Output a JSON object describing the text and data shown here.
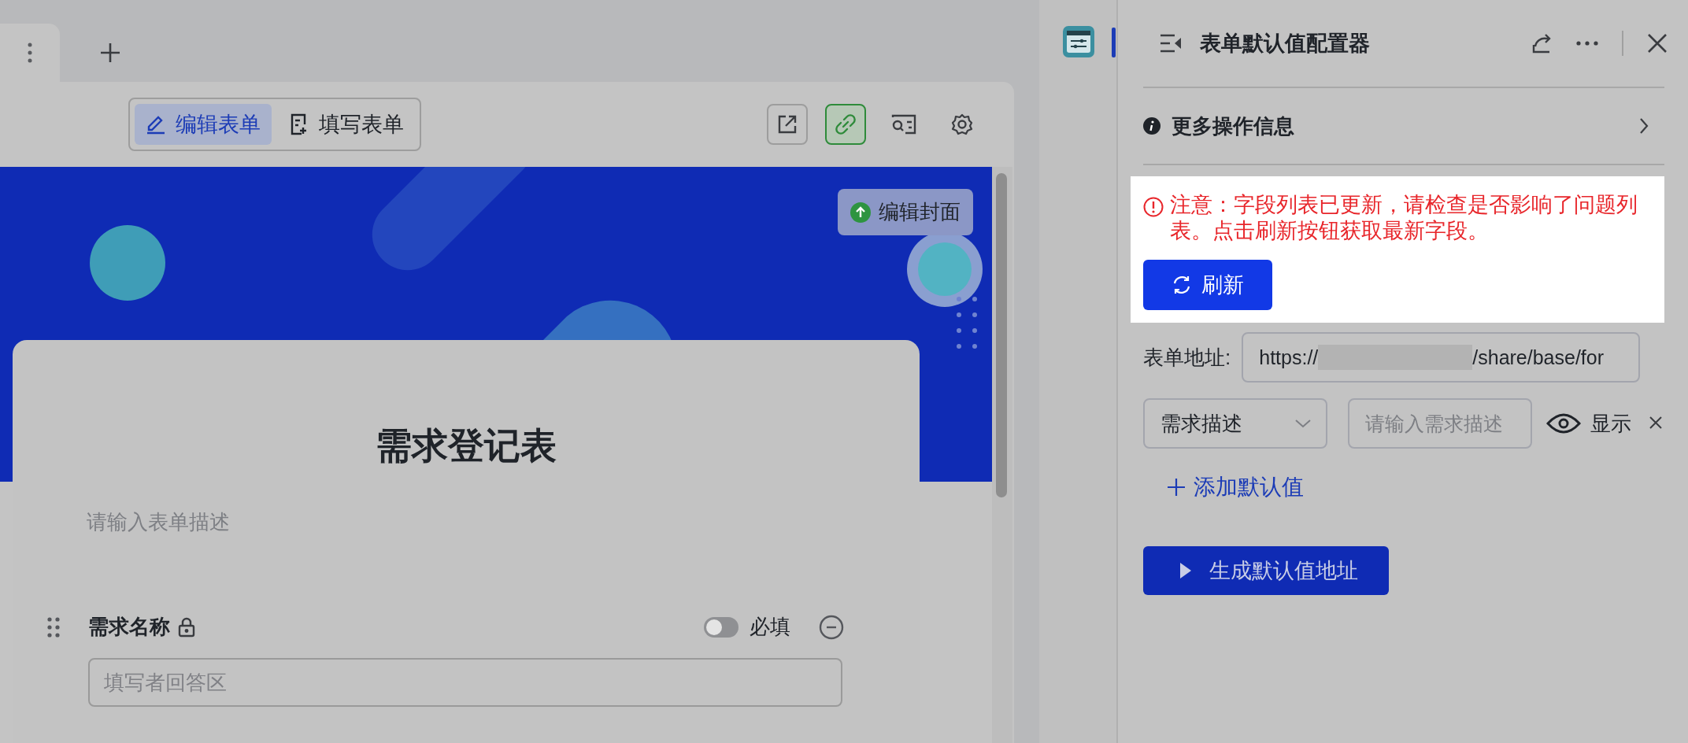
{
  "toolbar": {
    "modes": [
      {
        "label": "编辑表单",
        "selected": true,
        "kind": "edit"
      },
      {
        "label": "填写表单",
        "selected": false,
        "kind": "fill"
      }
    ],
    "link_on": true
  },
  "banner": {
    "edit_cover": "编辑封面"
  },
  "form": {
    "title": "需求登记表",
    "description_placeholder": "请输入表单描述",
    "fields": [
      {
        "label": "需求名称",
        "locked": true,
        "required": false,
        "required_label": "必填",
        "answer_placeholder": "填写者回答区"
      }
    ]
  },
  "panel": {
    "title": "表单默认值配置器",
    "more_info": "更多操作信息",
    "warning": "注意：字段列表已更新，请检查是否影响了问题列表。点击刷新按钮获取最新字段。",
    "refresh": "刷新",
    "address_label": "表单地址:",
    "address_start": "https://",
    "address_end": "/share/base/for",
    "defaults": [
      {
        "field": "需求描述",
        "placeholder": "请输入需求描述",
        "visible": true,
        "visibility_label": "显示"
      }
    ],
    "add_default": "添加默认值",
    "generate": "生成默认值地址"
  }
}
